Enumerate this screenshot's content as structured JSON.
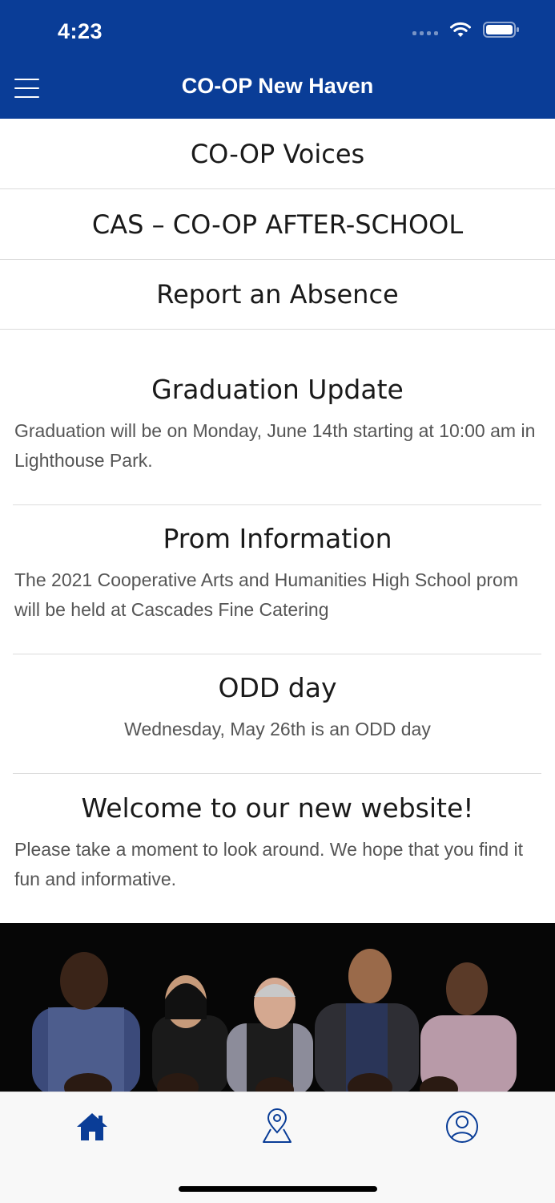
{
  "status_bar": {
    "time": "4:23",
    "signal_icon": "signal-icon",
    "wifi_icon": "wifi-icon",
    "battery_icon": "battery-icon"
  },
  "header": {
    "title": "CO-OP New Haven",
    "menu_icon": "menu-icon",
    "background": "#0a3d97"
  },
  "links": [
    {
      "label": "CO-OP Voices"
    },
    {
      "label": "CAS – CO-OP AFTER-SCHOOL"
    },
    {
      "label": "Report an Absence"
    }
  ],
  "announcements": [
    {
      "title": "Graduation Update",
      "body": "Graduation will be on Monday, June 14th starting at 10:00 am in Lighthouse Park."
    },
    {
      "title": "Prom Information",
      "body": "The 2021 Cooperative Arts and Humanities High School prom will be held at Cascades Fine Catering"
    },
    {
      "title": "ODD day",
      "body": "Wednesday, May 26th is an ODD day"
    },
    {
      "title": "Welcome to our new website!",
      "body": "Please take a moment to look around. We hope that you find it fun and informative."
    }
  ],
  "photo": {
    "icon": "group-photo"
  },
  "tabbar": {
    "tabs": [
      {
        "icon": "home-icon",
        "active": true
      },
      {
        "icon": "map-pin-icon",
        "active": false
      },
      {
        "icon": "profile-icon",
        "active": false
      }
    ],
    "accent_color": "#0a3d97"
  }
}
